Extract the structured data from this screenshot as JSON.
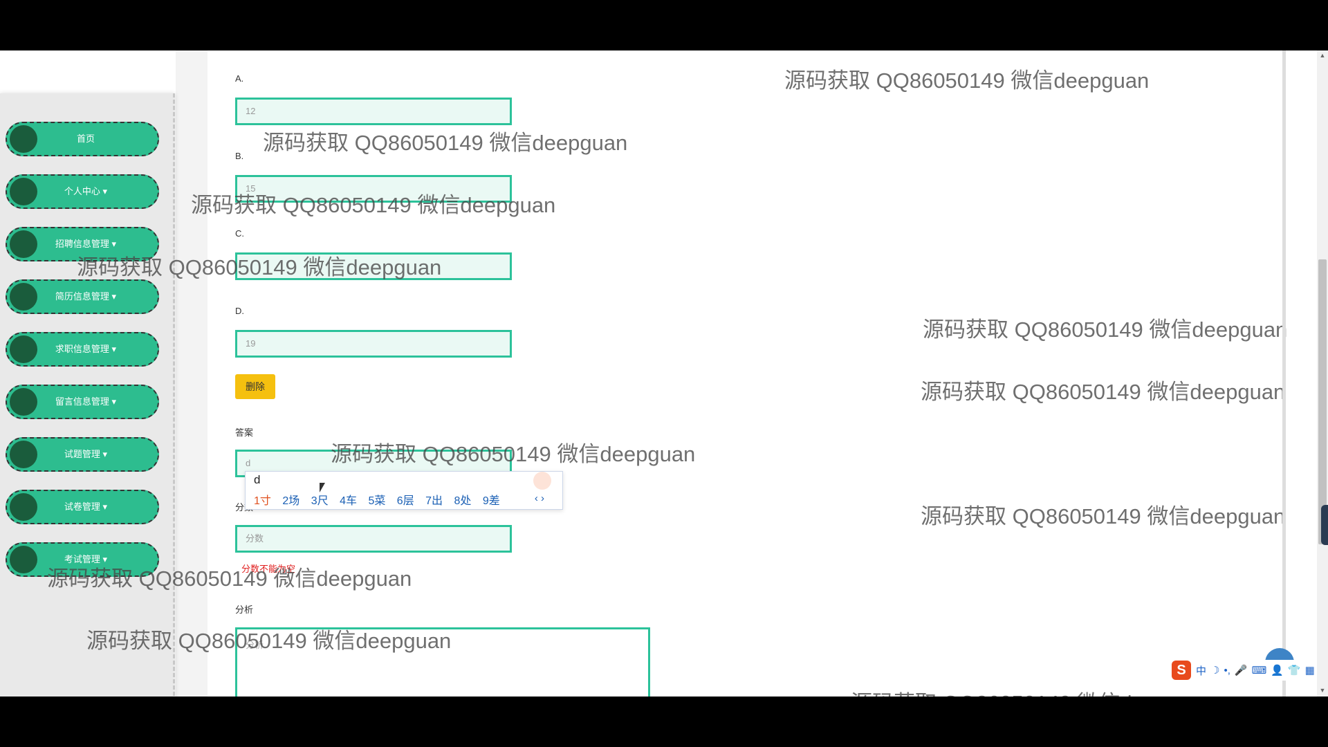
{
  "sidebar": {
    "items": [
      {
        "label": "首页"
      },
      {
        "label": "个人中心 ▾"
      },
      {
        "label": "招聘信息管理 ▾"
      },
      {
        "label": "简历信息管理 ▾"
      },
      {
        "label": "求职信息管理 ▾"
      },
      {
        "label": "留言信息管理 ▾"
      },
      {
        "label": "试题管理 ▾"
      },
      {
        "label": "试卷管理 ▾"
      },
      {
        "label": "考试管理 ▾"
      }
    ]
  },
  "form": {
    "option_a": {
      "label": "A.",
      "value": "12"
    },
    "option_b": {
      "label": "B.",
      "value": "15"
    },
    "option_c": {
      "label": "C.",
      "value": ""
    },
    "option_d": {
      "label": "D.",
      "value": "19"
    },
    "delete_label": "删除",
    "answer": {
      "label": "答案",
      "value": "d"
    },
    "score": {
      "label": "分数",
      "placeholder": "分数",
      "error": "分数不能为空"
    },
    "analysis": {
      "label": "分析",
      "placeholder": "分析"
    }
  },
  "ime": {
    "composition": "d",
    "candidates": [
      "1寸",
      "2场",
      "3尺",
      "4车",
      "5菜",
      "6层",
      "7出",
      "8处",
      "9差"
    ],
    "paging": "‹ ›"
  },
  "tray": {
    "logo": "S",
    "icons": [
      "中",
      "☽",
      "•,",
      "🎤",
      "⌨",
      "👤",
      "👕",
      "▦"
    ]
  },
  "watermark": "源码获取 QQ86050149 微信deepguan",
  "colors": {
    "accent": "#2cc29a",
    "nav_bg": "#2dbd8f",
    "nav_bullet": "#1a5c3c",
    "delete_btn": "#f5c00f",
    "error": "#e02020"
  }
}
